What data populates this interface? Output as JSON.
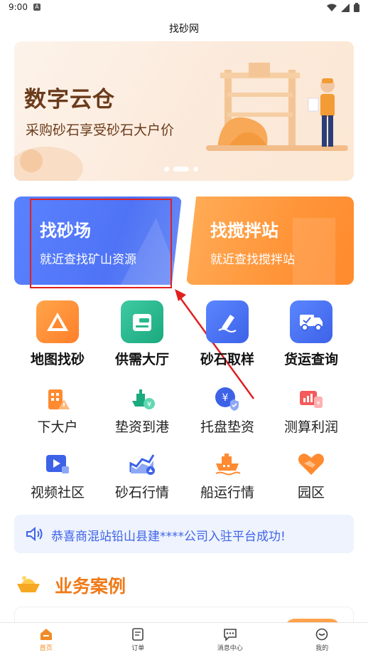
{
  "status_bar": {
    "time": "9:00",
    "app_badge": "A"
  },
  "app_title": "找砂网",
  "banner": {
    "title": "数字云仓",
    "subtitle": "采购砂石享受砂石大户价"
  },
  "cards": [
    {
      "title": "找砂场",
      "subtitle": "就近查找矿山资源"
    },
    {
      "title": "找搅拌站",
      "subtitle": "就近查找搅拌站"
    }
  ],
  "grid_primary": [
    {
      "label": "地图找砂",
      "icon": "map-mountain-icon"
    },
    {
      "label": "供需大厅",
      "icon": "market-hall-icon"
    },
    {
      "label": "砂石取样",
      "icon": "sample-pen-icon"
    },
    {
      "label": "货运查询",
      "icon": "truck-icon"
    }
  ],
  "grid_secondary": [
    {
      "label": "下大户",
      "icon": "building-warning-icon"
    },
    {
      "label": "垫资到港",
      "icon": "ship-coin-icon"
    },
    {
      "label": "托盘垫资",
      "icon": "yen-shield-icon"
    },
    {
      "label": "测算利润",
      "icon": "profit-chart-icon"
    },
    {
      "label": "视频社区",
      "icon": "video-icon"
    },
    {
      "label": "砂石行情",
      "icon": "trend-chart-icon"
    },
    {
      "label": "船运行情",
      "icon": "cargo-ship-icon"
    },
    {
      "label": "园区",
      "icon": "handshake-heart-icon"
    }
  ],
  "notice": {
    "text": "恭喜商混站铅山县建****公司入驻平台成功!"
  },
  "section": {
    "title": "业务案例"
  },
  "bottom_nav": [
    {
      "label": "首页",
      "icon": "home-icon",
      "active": true
    },
    {
      "label": "订单",
      "icon": "order-icon",
      "active": false
    },
    {
      "label": "消息中心",
      "icon": "message-icon",
      "active": false
    },
    {
      "label": "我的",
      "icon": "profile-icon",
      "active": false
    }
  ],
  "colors": {
    "primary_blue": "#4f73f5",
    "primary_orange": "#ff9438",
    "annotation_red": "#e02020"
  }
}
